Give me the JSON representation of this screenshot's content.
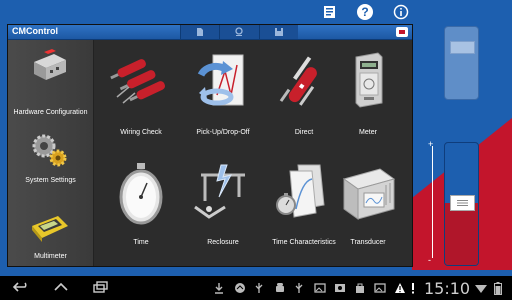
{
  "window": {
    "title": "CMControl"
  },
  "left_panel": {
    "items": [
      {
        "label": "Hardware Configuration",
        "icon": "hardware-box-icon"
      },
      {
        "label": "System Settings",
        "icon": "gears-icon"
      },
      {
        "label": "Multimeter",
        "icon": "multimeter-icon"
      }
    ]
  },
  "grid": {
    "items": [
      {
        "label": "Wiring Check",
        "icon": "wiring-plugs-icon"
      },
      {
        "label": "Pick-Up/Drop-Off",
        "icon": "pickup-dropoff-arrows-icon"
      },
      {
        "label": "Direct",
        "icon": "swiss-knife-icon"
      },
      {
        "label": "Meter",
        "icon": "meter-icon"
      },
      {
        "label": "Time",
        "icon": "stopwatch-icon"
      },
      {
        "label": "Reclosure",
        "icon": "reclosure-lightning-icon"
      },
      {
        "label": "Time Characteristics",
        "icon": "time-characteristics-icon"
      },
      {
        "label": "Transducer",
        "icon": "transducer-icon"
      }
    ]
  },
  "slider": {
    "plus": "+",
    "minus": "-"
  },
  "status": {
    "time": "15:10"
  },
  "colors": {
    "background_blue": "#1d5faf",
    "accent_red": "#c3152c",
    "titlebar_blue": "#2f73c4",
    "panel_gray": "#2c2c2c"
  }
}
